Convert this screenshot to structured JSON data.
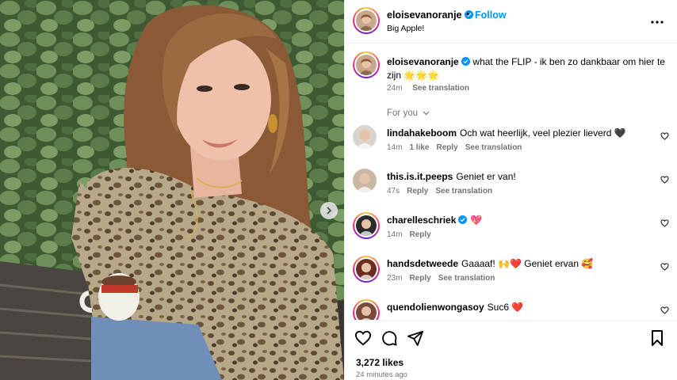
{
  "post": {
    "username": "eloisevanoranje",
    "separator": "•",
    "follow_label": "Follow",
    "location": "Big Apple!",
    "more_label": "•••"
  },
  "caption": {
    "username": "eloisevanoranje",
    "text": "what the FLIP - ik ben zo dankbaar om hier te zijn 🌟🌟🌟",
    "time": "24m",
    "translate": "See translation"
  },
  "comments_filter": "For you",
  "comments": [
    {
      "user": "lindahakeboom",
      "text": "Och wat heerlijk, veel plezier lieverd 🖤",
      "time": "14m",
      "likes": "1 like",
      "reply": "Reply",
      "translate": "See translation",
      "verified": false,
      "avatar_color": "#d9d4cf"
    },
    {
      "user": "this.is.it.peeps",
      "text": "Geniet er van!",
      "time": "47s",
      "likes": "",
      "reply": "Reply",
      "translate": "See translation",
      "verified": false,
      "avatar_color": "#c9b8a3"
    },
    {
      "user": "charelleschriek",
      "text": "💖",
      "time": "14m",
      "likes": "",
      "reply": "Reply",
      "translate": "",
      "verified": true,
      "avatar_color": "#2b2b2b"
    },
    {
      "user": "handsdetweede",
      "text": "Gaaaaf! 🙌❤️ Geniet ervan 🥰",
      "time": "23m",
      "likes": "",
      "reply": "Reply",
      "translate": "See translation",
      "verified": false,
      "avatar_color": "#6b2d22"
    },
    {
      "user": "quendolienwongasoy",
      "text": "Suc6 ❤️",
      "time": "",
      "likes": "",
      "reply": "",
      "translate": "",
      "verified": false,
      "avatar_color": "#7a4a3a"
    }
  ],
  "footer": {
    "likes": "3,272 likes",
    "time": "24 minutes ago"
  },
  "colors": {
    "accent": "#0095f6",
    "muted": "#737373",
    "verified": "#0095f6"
  }
}
